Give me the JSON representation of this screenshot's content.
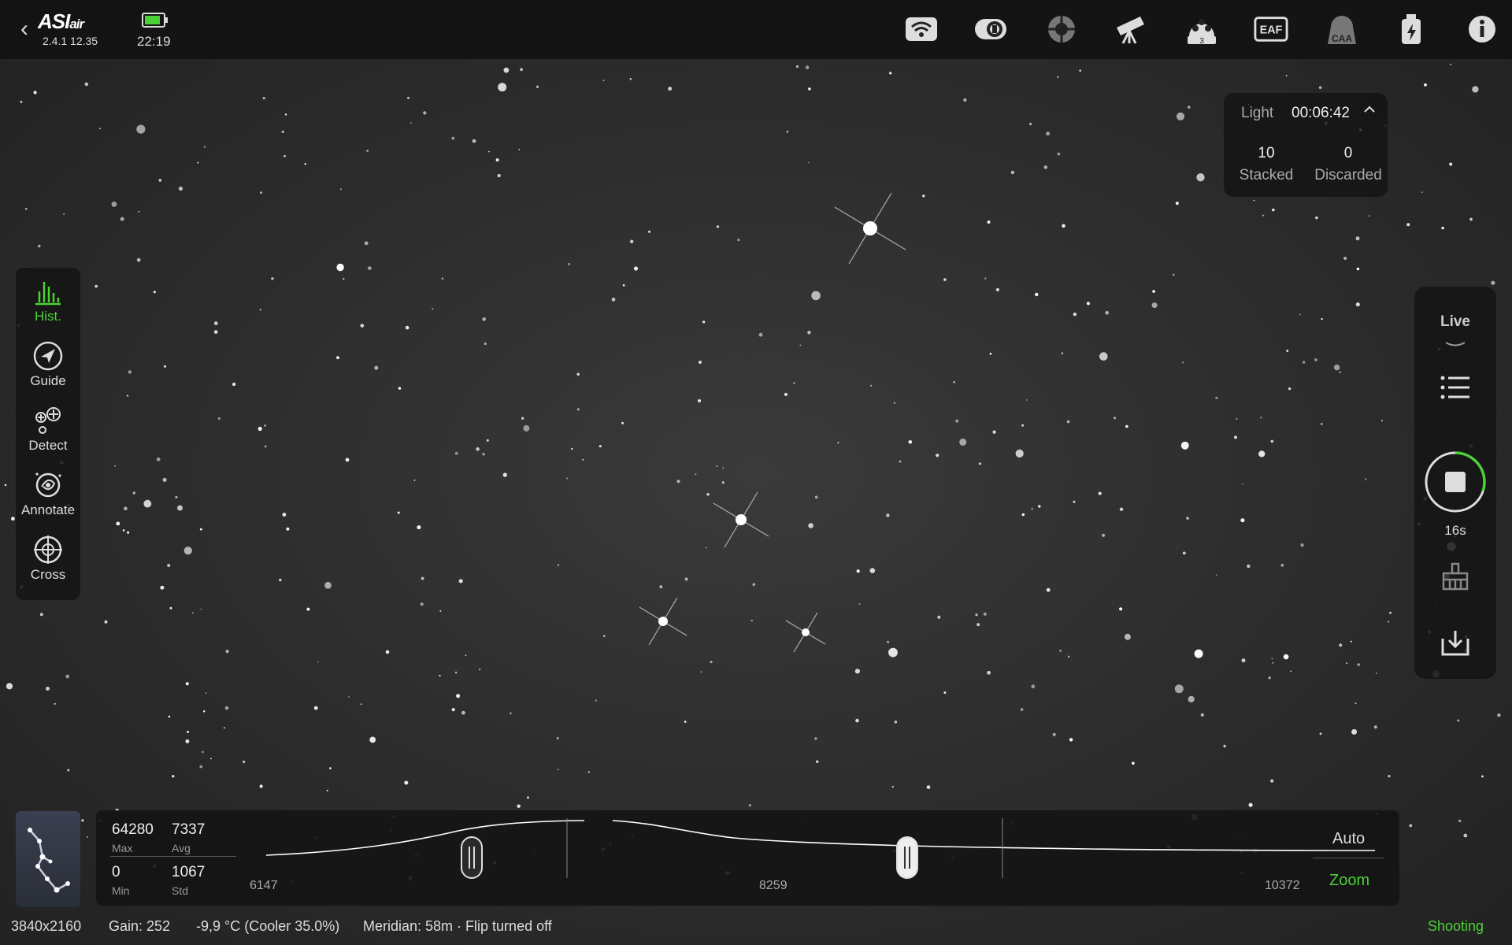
{
  "app": {
    "logo": "ASI",
    "logo_suffix": "air",
    "version": "2.4.1 12.35",
    "clock": "22:19",
    "battery_level": 0.85,
    "battery_color": "#4cd137"
  },
  "top_icons": [
    {
      "name": "wifi-icon"
    },
    {
      "name": "camera-icon"
    },
    {
      "name": "guide-camera-icon"
    },
    {
      "name": "telescope-icon"
    },
    {
      "name": "filter-wheel-icon",
      "badge": "3"
    },
    {
      "name": "eaf-icon",
      "text": "EAF"
    },
    {
      "name": "caa-icon",
      "text": "CAA"
    },
    {
      "name": "power-icon"
    },
    {
      "name": "info-icon"
    }
  ],
  "stats": {
    "mode": "Light",
    "elapsed": "00:06:42",
    "stacked_value": "10",
    "stacked_label": "Stacked",
    "discarded_value": "0",
    "discarded_label": "Discarded"
  },
  "left_tools": [
    {
      "label": "Hist.",
      "icon": "histogram-icon",
      "active": true
    },
    {
      "label": "Guide",
      "icon": "guide-icon",
      "active": false
    },
    {
      "label": "Detect",
      "icon": "detect-icon",
      "active": false
    },
    {
      "label": "Annotate",
      "icon": "annotate-icon",
      "active": false
    },
    {
      "label": "Cross",
      "icon": "crosshair-icon",
      "active": false
    }
  ],
  "right_panel": {
    "live_label": "Live",
    "exposure_label": "16s",
    "progress": 0.3
  },
  "histogram": {
    "max_value": "64280",
    "max_label": "Max",
    "avg_value": "7337",
    "avg_label": "Avg",
    "min_value": "0",
    "min_label": "Min",
    "std_value": "1067",
    "std_label": "Std",
    "axis_left": "6147",
    "axis_mid": "8259",
    "axis_right": "10372",
    "auto_label": "Auto",
    "zoom_label": "Zoom"
  },
  "status_bar": {
    "resolution": "3840x2160",
    "gain": "Gain: 252",
    "temperature": "-9,9 °C (Cooler 35.0%)",
    "meridian": "Meridian: 58m · Flip turned off",
    "state": "Shooting"
  },
  "colors": {
    "accent": "#4cd137",
    "panel": "#141414",
    "sky": "#2e2e2e"
  }
}
